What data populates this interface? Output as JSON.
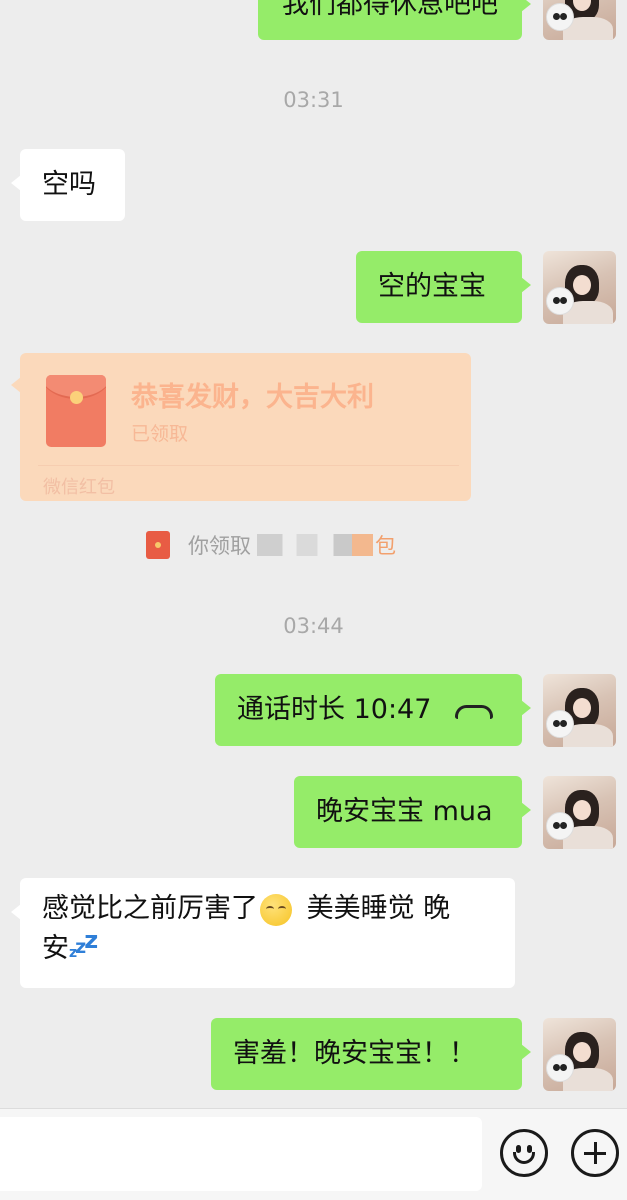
{
  "messages": {
    "partial_top": "我们都得休息吧吧",
    "ts1": "03:31",
    "m1": "空吗",
    "m2": "空的宝宝",
    "red_packet": {
      "title": "恭喜发财，大吉大利",
      "status": "已领取",
      "footer": "微信红包"
    },
    "system_note": {
      "prefix": "你领取",
      "suffix": "包"
    },
    "ts2": "03:44",
    "call": {
      "label": "通话时长 10:47"
    },
    "m3": "晚安宝宝 mua",
    "m4": {
      "line1_a": "感觉比之前厉害了",
      "line1_b": " 美美睡觉 晚",
      "line2": "安"
    },
    "m5": "害羞！晚安宝宝！！"
  },
  "icons": {
    "emoji_button": "smiley-face-icon",
    "more_button": "plus-circle-icon",
    "call": "phone-hangup-icon",
    "red_packet": "red-envelope-icon"
  },
  "colors": {
    "outgoing_bubble": "#95ec69",
    "incoming_bubble": "#ffffff",
    "background": "#ededed",
    "red_packet_bg": "#fbd9bb"
  }
}
